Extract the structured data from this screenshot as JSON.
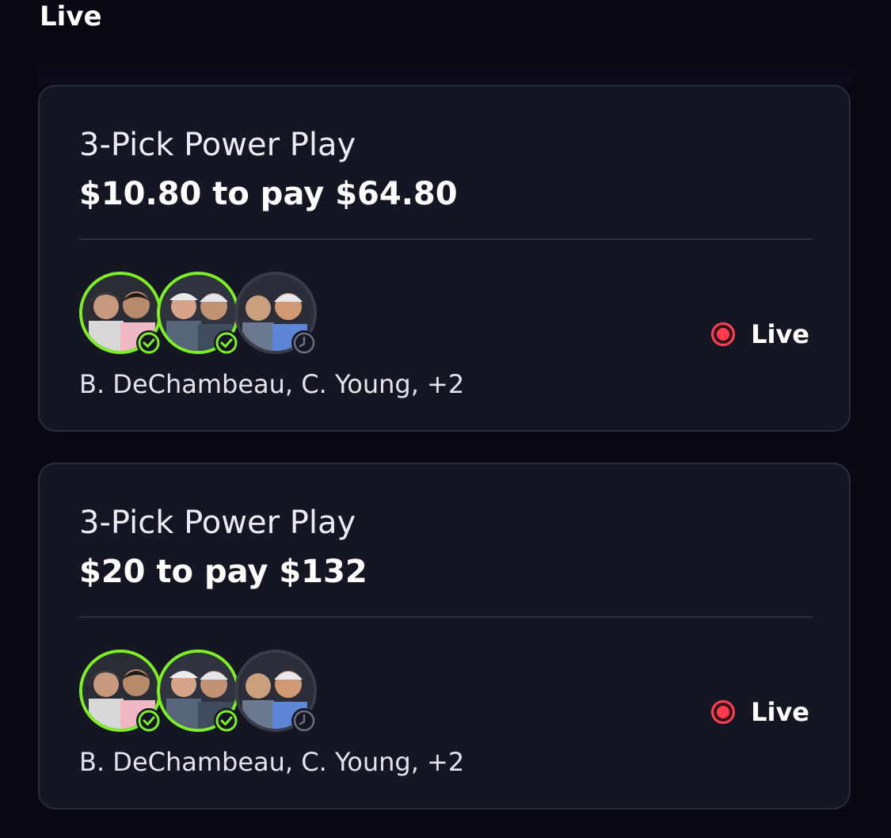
{
  "section": {
    "title": "Live"
  },
  "colors": {
    "background": "#070812",
    "card": "#141624",
    "win_ring": "#7cf024",
    "pending_ring": "#3a3c4a",
    "live": "#ff3b4e"
  },
  "entries": [
    {
      "type": "3-Pick Power Play",
      "amount": "$10.80 to pay $64.80",
      "players": "B. DeChambeau, C. Young, +2",
      "status": "Live",
      "picks": [
        {
          "state": "won",
          "badge_icon": "check-circle-icon"
        },
        {
          "state": "won",
          "badge_icon": "check-circle-icon"
        },
        {
          "state": "pending",
          "badge_icon": "clock-icon"
        }
      ]
    },
    {
      "type": "3-Pick Power Play",
      "amount": "$20 to pay $132",
      "players": "B. DeChambeau, C. Young, +2",
      "status": "Live",
      "picks": [
        {
          "state": "won",
          "badge_icon": "check-circle-icon"
        },
        {
          "state": "won",
          "badge_icon": "check-circle-icon"
        },
        {
          "state": "pending",
          "badge_icon": "clock-icon"
        }
      ]
    }
  ]
}
